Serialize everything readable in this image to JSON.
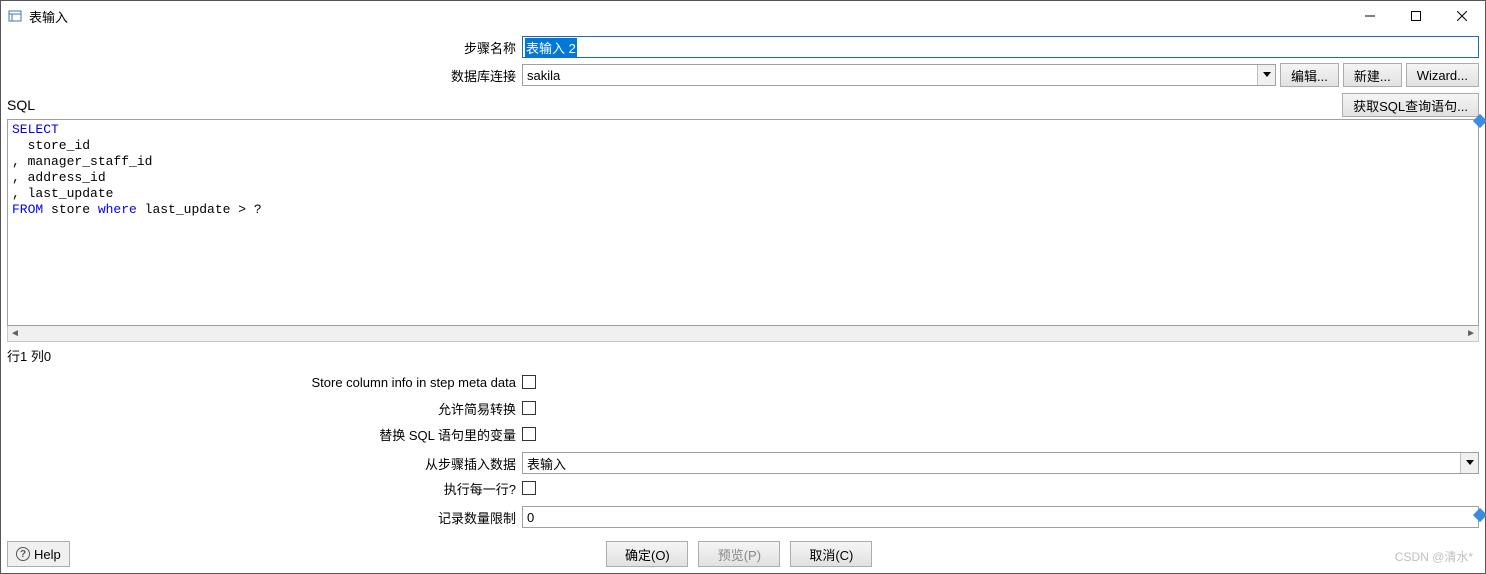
{
  "window": {
    "title": "表输入"
  },
  "form": {
    "step_name_label": "步骤名称",
    "step_name_value": "表输入 2",
    "db_conn_label": "数据库连接",
    "db_conn_value": "sakila",
    "edit_btn": "编辑...",
    "new_btn": "新建...",
    "wizard_btn": "Wizard..."
  },
  "sql": {
    "label": "SQL",
    "get_query_btn": "获取SQL查询语句...",
    "body_plain": "SELECT\n  store_id\n, manager_staff_id\n, address_id\n, last_update\nFROM store where last_update > ?",
    "status": "行1 列0"
  },
  "options": {
    "store_column_info": "Store column info in step meta data",
    "allow_simple": "允许简易转换",
    "replace_vars": "替换 SQL 语句里的变量",
    "insert_from_step": "从步骤插入数据",
    "insert_from_value": "表输入",
    "execute_each": "执行每一行?",
    "limit_label": "记录数量限制",
    "limit_value": "0"
  },
  "buttons": {
    "help": "Help",
    "ok": "确定(O)",
    "preview": "预览(P)",
    "cancel": "取消(C)"
  },
  "watermark": "CSDN @清水*"
}
